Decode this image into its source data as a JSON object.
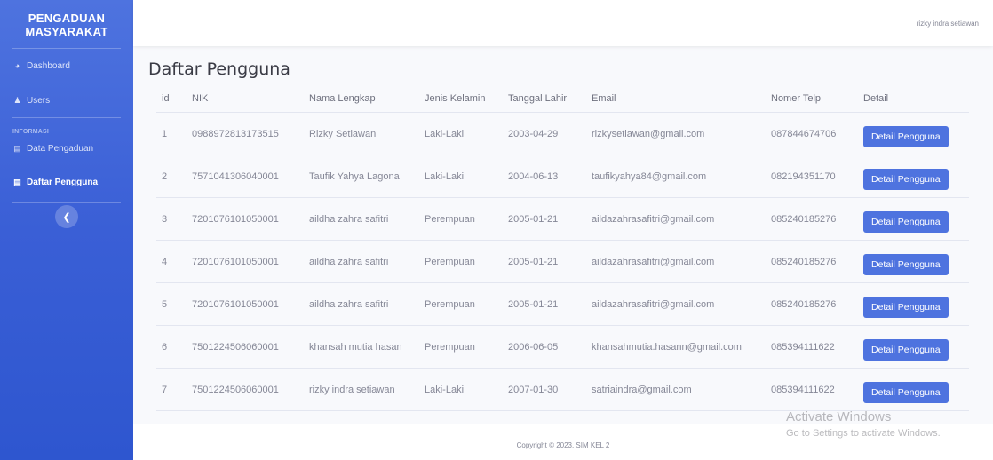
{
  "sidebar": {
    "brand_line1": "PENGADUAN",
    "brand_line2": "MASYARAKAT",
    "items": [
      {
        "label": "Dashboard",
        "icon": "dashboard-icon"
      },
      {
        "label": "Users",
        "icon": "user-icon"
      }
    ],
    "section_heading": "INFORMASI",
    "info_items": [
      {
        "label": "Data Pengaduan",
        "icon": "table-icon"
      },
      {
        "label": "Daftar Pengguna",
        "icon": "table-icon",
        "active": true
      }
    ],
    "toggle_icon": "chevron-left-icon"
  },
  "topbar": {
    "user_name": "rizky indra setiawan"
  },
  "page": {
    "title": "Daftar Pengguna"
  },
  "table": {
    "headers": [
      "id",
      "NIK",
      "Nama Lengkap",
      "Jenis Kelamin",
      "Tanggal Lahir",
      "Email",
      "Nomer Telp",
      "Detail"
    ],
    "rows": [
      {
        "id": "1",
        "nik": "0988972813173515",
        "nama": "Rizky Setiawan",
        "jk": "Laki-Laki",
        "tgl": "2003-04-29",
        "email": "rizkysetiawan@gmail.com",
        "telp": "087844674706",
        "detail": "Detail Pengguna"
      },
      {
        "id": "2",
        "nik": "7571041306040001",
        "nama": "Taufik Yahya Lagona",
        "jk": "Laki-Laki",
        "tgl": "2004-06-13",
        "email": "taufikyahya84@gmail.com",
        "telp": "082194351170",
        "detail": "Detail Pengguna"
      },
      {
        "id": "3",
        "nik": "7201076101050001",
        "nama": "aildha zahra safitri",
        "jk": "Perempuan",
        "tgl": "2005-01-21",
        "email": "aildazahrasafitri@gmail.com",
        "telp": "085240185276",
        "detail": "Detail Pengguna"
      },
      {
        "id": "4",
        "nik": "7201076101050001",
        "nama": "aildha zahra safitri",
        "jk": "Perempuan",
        "tgl": "2005-01-21",
        "email": "aildazahrasafitri@gmail.com",
        "telp": "085240185276",
        "detail": "Detail Pengguna"
      },
      {
        "id": "5",
        "nik": "7201076101050001",
        "nama": "aildha zahra safitri",
        "jk": "Perempuan",
        "tgl": "2005-01-21",
        "email": "aildazahrasafitri@gmail.com",
        "telp": "085240185276",
        "detail": "Detail Pengguna"
      },
      {
        "id": "6",
        "nik": "7501224506060001",
        "nama": "khansah mutia hasan",
        "jk": "Perempuan",
        "tgl": "2006-06-05",
        "email": "khansahmutia.hasann@gmail.com",
        "telp": "085394111622",
        "detail": "Detail Pengguna"
      },
      {
        "id": "7",
        "nik": "7501224506060001",
        "nama": "rizky indra setiawan",
        "jk": "Laki-Laki",
        "tgl": "2007-01-30",
        "email": "satriaindra@gmail.com",
        "telp": "085394111622",
        "detail": "Detail Pengguna"
      }
    ]
  },
  "footer": {
    "copyright": "Copyright © 2023. SIM KEL 2"
  },
  "watermark": {
    "line1": "Activate Windows",
    "line2": "Go to Settings to activate Windows."
  },
  "colors": {
    "sidebar": "#4e73df",
    "button": "#4e73df",
    "background": "#f8f9fc"
  }
}
